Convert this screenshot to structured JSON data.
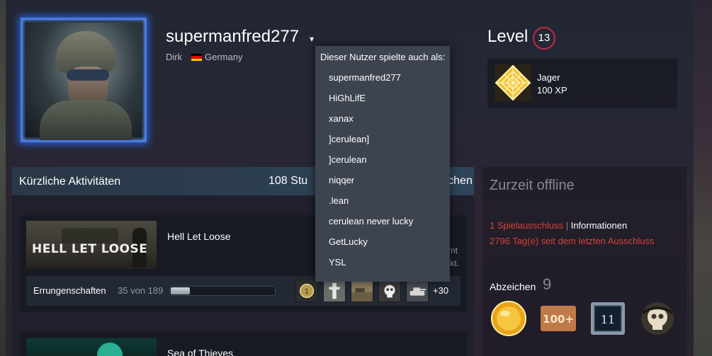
{
  "profile": {
    "username": "supermanfred277",
    "real_name": "Dirk",
    "country": "Germany",
    "flag_colors": [
      "#000000",
      "#dd0000",
      "#ffce00"
    ]
  },
  "level": {
    "label": "Level",
    "value": "13",
    "badge_name": "Jager",
    "xp": "100 XP"
  },
  "alias_dropdown": {
    "title": "Dieser Nutzer spielte auch als:",
    "items": [
      "supermanfred277",
      "HiGhLifE",
      "xanax",
      "]cerulean]",
      "]cerulean",
      "niqqer",
      ".lean",
      "cerulean never lucky",
      "GetLucky",
      "YSL"
    ]
  },
  "recent_activity": {
    "title": "Kürzliche Aktivitäten",
    "hours_text": "108 Stu",
    "hours_tail": "chen",
    "games": [
      {
        "name": "Hell Let Loose",
        "capsule_logo": "HELL LET LOOSE",
        "side_text_1": "amt",
        "side_text_2": "Okt.",
        "achievements_label": "Errungenschaften",
        "achievements_count": "35 von 189",
        "achievements_progress": 0.185,
        "more_achievements": "+30"
      },
      {
        "name": "Sea of Thieves"
      }
    ]
  },
  "status": {
    "text": "Zurzeit offline",
    "ban_count": "1 Spielausschluss",
    "ban_separator": "|",
    "ban_info_link": "Informationen",
    "ban_days": "2796 Tag(e) seit dem letzten Ausschluss"
  },
  "badges": {
    "label": "Abzeichen",
    "count": "9",
    "items": [
      "gold-coin-badge",
      "100-plus-badge",
      "years-of-service-badge",
      "sea-of-thieves-skull-badge"
    ],
    "third_badge_text": "11",
    "second_badge_text": "100+"
  },
  "colors": {
    "accent_red": "#c02942",
    "ban_red": "#d9423a",
    "dropdown_bg": "#3d4450",
    "avatar_glow": "#2c64e8"
  }
}
